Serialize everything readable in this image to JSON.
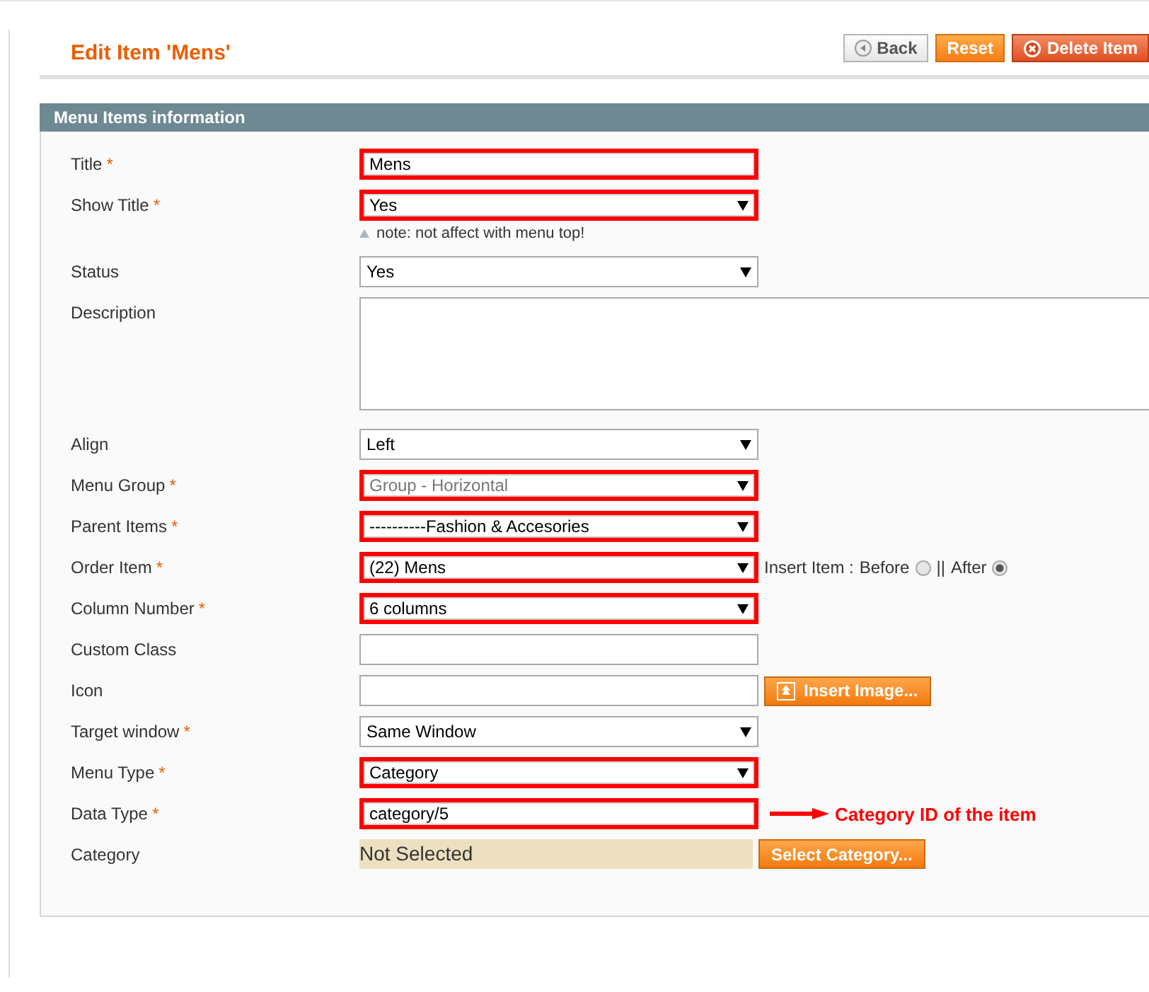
{
  "header": {
    "title": "Edit Item 'Mens'",
    "buttons": [
      {
        "kind": "back",
        "label": "Back"
      },
      {
        "kind": "reset",
        "label": "Reset"
      },
      {
        "kind": "delete",
        "label": "Delete Item"
      }
    ]
  },
  "section": {
    "title": "Menu Items information"
  },
  "fields": [
    {
      "kind": "text",
      "label": "Title",
      "mark": "*",
      "value": "Mens",
      "highlighted": true
    },
    {
      "kind": "select",
      "label": "Show Title",
      "mark": "*",
      "value": "Yes",
      "highlighted": true,
      "note": "note: not affect with menu top!"
    },
    {
      "kind": "select",
      "label": "Status",
      "value": "Yes",
      "highlighted": false
    },
    {
      "kind": "textarea",
      "label": "Description",
      "highlighted": false
    },
    {
      "kind": "select",
      "label": "Align",
      "value": "Left",
      "highlighted": false
    },
    {
      "kind": "select",
      "label": "Menu Group",
      "mark": "*",
      "value": "Group - Horizontal",
      "highlighted": true,
      "disabled": true
    },
    {
      "kind": "select",
      "label": "Parent Items",
      "mark": "*",
      "value": "----------Fashion & Accesories",
      "highlighted": true
    },
    {
      "kind": "select",
      "label": "Order Item",
      "mark": "*",
      "value": "(22) Mens",
      "highlighted": true,
      "insert_position": {
        "label": "Insert Item :",
        "separator": "||",
        "options": [
          {
            "label": "Before",
            "selected": false
          },
          {
            "label": "After",
            "selected": true
          }
        ]
      }
    },
    {
      "kind": "select",
      "label": "Column Number",
      "mark": "*",
      "value": "6 columns",
      "highlighted": true
    },
    {
      "kind": "text",
      "label": "Custom Class",
      "highlighted": false
    },
    {
      "kind": "text_button",
      "label": "Icon",
      "highlighted": false,
      "button": "Insert Image..."
    },
    {
      "kind": "select",
      "label": "Target window",
      "mark": "*",
      "value": "Same Window",
      "highlighted": false
    },
    {
      "kind": "select",
      "label": "Menu Type",
      "mark": "*",
      "value": "Category",
      "highlighted": true
    },
    {
      "kind": "text",
      "label": "Data Type",
      "mark": "*",
      "value": "category/5",
      "highlighted": true,
      "annotation": "Category ID of the item"
    },
    {
      "kind": "display_button",
      "label": "Category",
      "value": "Not Selected",
      "highlighted": false,
      "button": "Select Category..."
    }
  ]
}
